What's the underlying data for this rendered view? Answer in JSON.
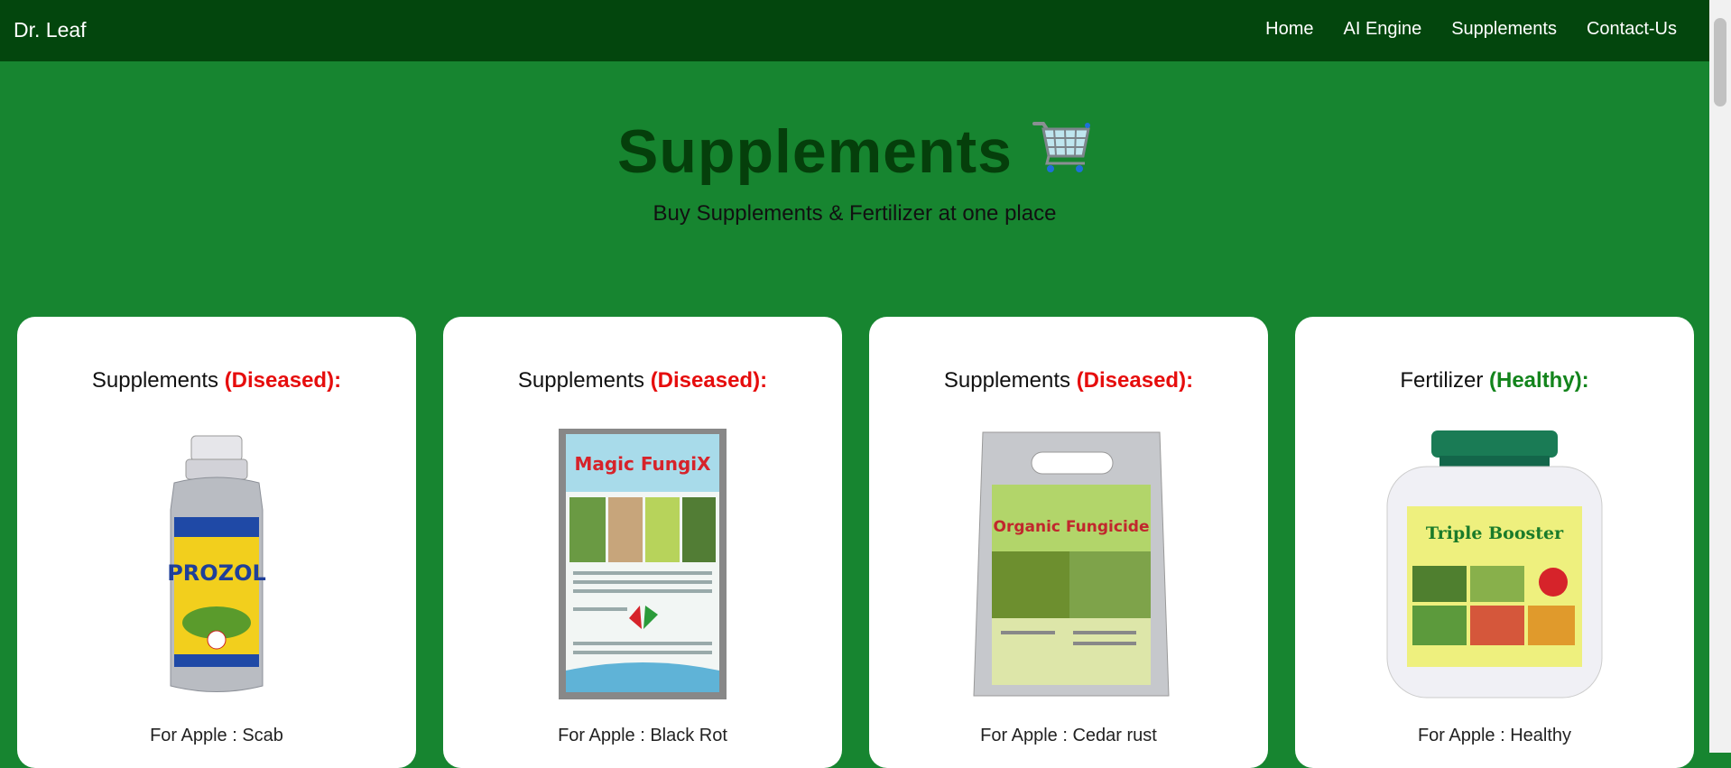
{
  "navbar": {
    "brand": "Dr. Leaf",
    "links": [
      "Home",
      "AI Engine",
      "Supplements",
      "Contact-Us"
    ]
  },
  "hero": {
    "title": "Supplements",
    "icon": "shopping-cart-icon",
    "subtitle": "Buy Supplements & Fertilizer at one place"
  },
  "cards": [
    {
      "prefix": "Supplements",
      "status": "(Diseased):",
      "caption": "For Apple : Scab",
      "product_text": "PROZOL"
    },
    {
      "prefix": "Supplements",
      "status": "(Diseased):",
      "caption": "For Apple : Black Rot",
      "product_text": "Magic FungiX"
    },
    {
      "prefix": "Supplements",
      "status": "(Diseased):",
      "caption": "For Apple : Cedar rust",
      "product_text": "Organic Fungicide"
    },
    {
      "prefix": "Fertilizer",
      "status": "(Healthy):",
      "caption": "For Apple : Healthy",
      "product_text": "Triple Booster"
    }
  ],
  "colors": {
    "page_background": "#178530",
    "navbar": "#03460d",
    "title": "#053f0b",
    "diseased": "#e60d0d",
    "healthy": "#13841c"
  }
}
